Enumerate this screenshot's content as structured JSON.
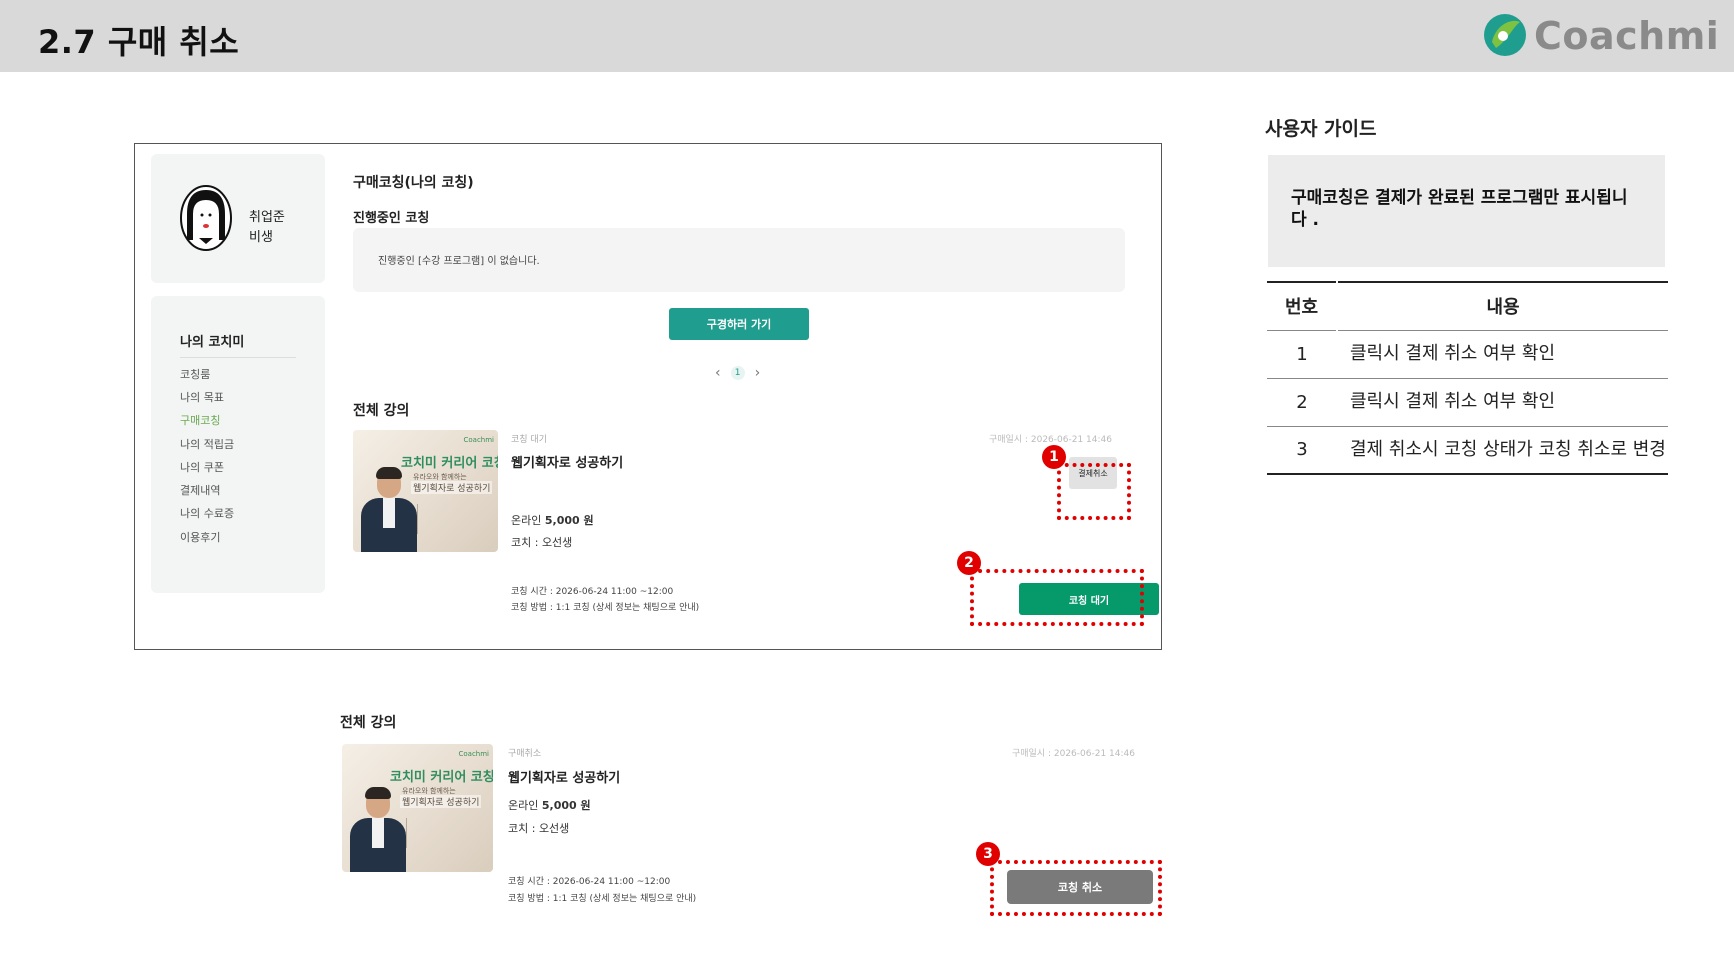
{
  "header": {
    "title": "2.7  구매 취소",
    "logo_text": "Coachmi"
  },
  "mock": {
    "profile": {
      "name_line1": "취업준",
      "name_line2": "비생"
    },
    "menu": {
      "title": "나의 코치미",
      "items": [
        "코칭룸",
        "나의 목표",
        "구매코칭",
        "나의 적립금",
        "나의 쿠폰",
        "결제내역",
        "나의 수료증",
        "이용후기"
      ],
      "active_index": 2
    },
    "purchase_title": "구매코칭(나의 코칭)",
    "ongoing_title": "진행중인 코칭",
    "empty_text": "진행중인 [수강 프로그램] 이 없습니다.",
    "go_button": "구경하러 가기",
    "pager": {
      "prev": "‹",
      "page": "1",
      "next": "›"
    },
    "all_title": "전체 강의",
    "course": {
      "thumb_logo": "Coachmi",
      "thumb_title": "코치미 커리어 코칭",
      "thumb_sub": "유라오와 함께하는",
      "thumb_sub2": "웹기획자로 성공하기",
      "status": "코칭 대기",
      "date": "구매일시 : 2026-06-21 14:46",
      "name": "웹기획자로 성공하기",
      "price_prefix": "온라인",
      "price": "5,000 원",
      "coach": "코치 : 오선생",
      "time": "코칭 시간 : 2026-06-24 11:00 ~12:00",
      "method": "코칭 방법 : 1:1 코칭 (상세 정보는 채팅으로 안내)",
      "cancel_payment_button": "결제취소",
      "wait_button": "코칭 대기"
    }
  },
  "after": {
    "all_title": "전체 강의",
    "status": "구매취소",
    "date": "구매일시 : 2026-06-21 14:46",
    "name": "웹기획자로 성공하기",
    "price_prefix": "온라인",
    "price": "5,000 원",
    "coach": "코치 : 오선생",
    "time": "코칭 시간 : 2026-06-24 11:00 ~12:00",
    "method": "코칭 방법 : 1:1 코칭 (상세 정보는 채팅으로 안내)",
    "cancel_button": "코칭 취소"
  },
  "badges": [
    "1",
    "2",
    "3"
  ],
  "guide": {
    "heading": "사용자 가이드",
    "note": "구매코칭은 결제가 완료된 프로그램만 표시됩니다 .",
    "table": {
      "headers": [
        "번호",
        "내용"
      ],
      "rows": [
        {
          "no": "1",
          "desc": "클릭시 결제 취소 여부 확인"
        },
        {
          "no": "2",
          "desc": "클릭시 결제 취소 여부 확인"
        },
        {
          "no": "3",
          "desc": "결제 취소시 코칭 상태가 코칭 취소로 변경"
        }
      ]
    }
  },
  "colors": {
    "accent": "#1f9e8f",
    "wait_button": "#069a6b",
    "highlight": "#e00000",
    "cancel_button": "#7a7a7a"
  }
}
